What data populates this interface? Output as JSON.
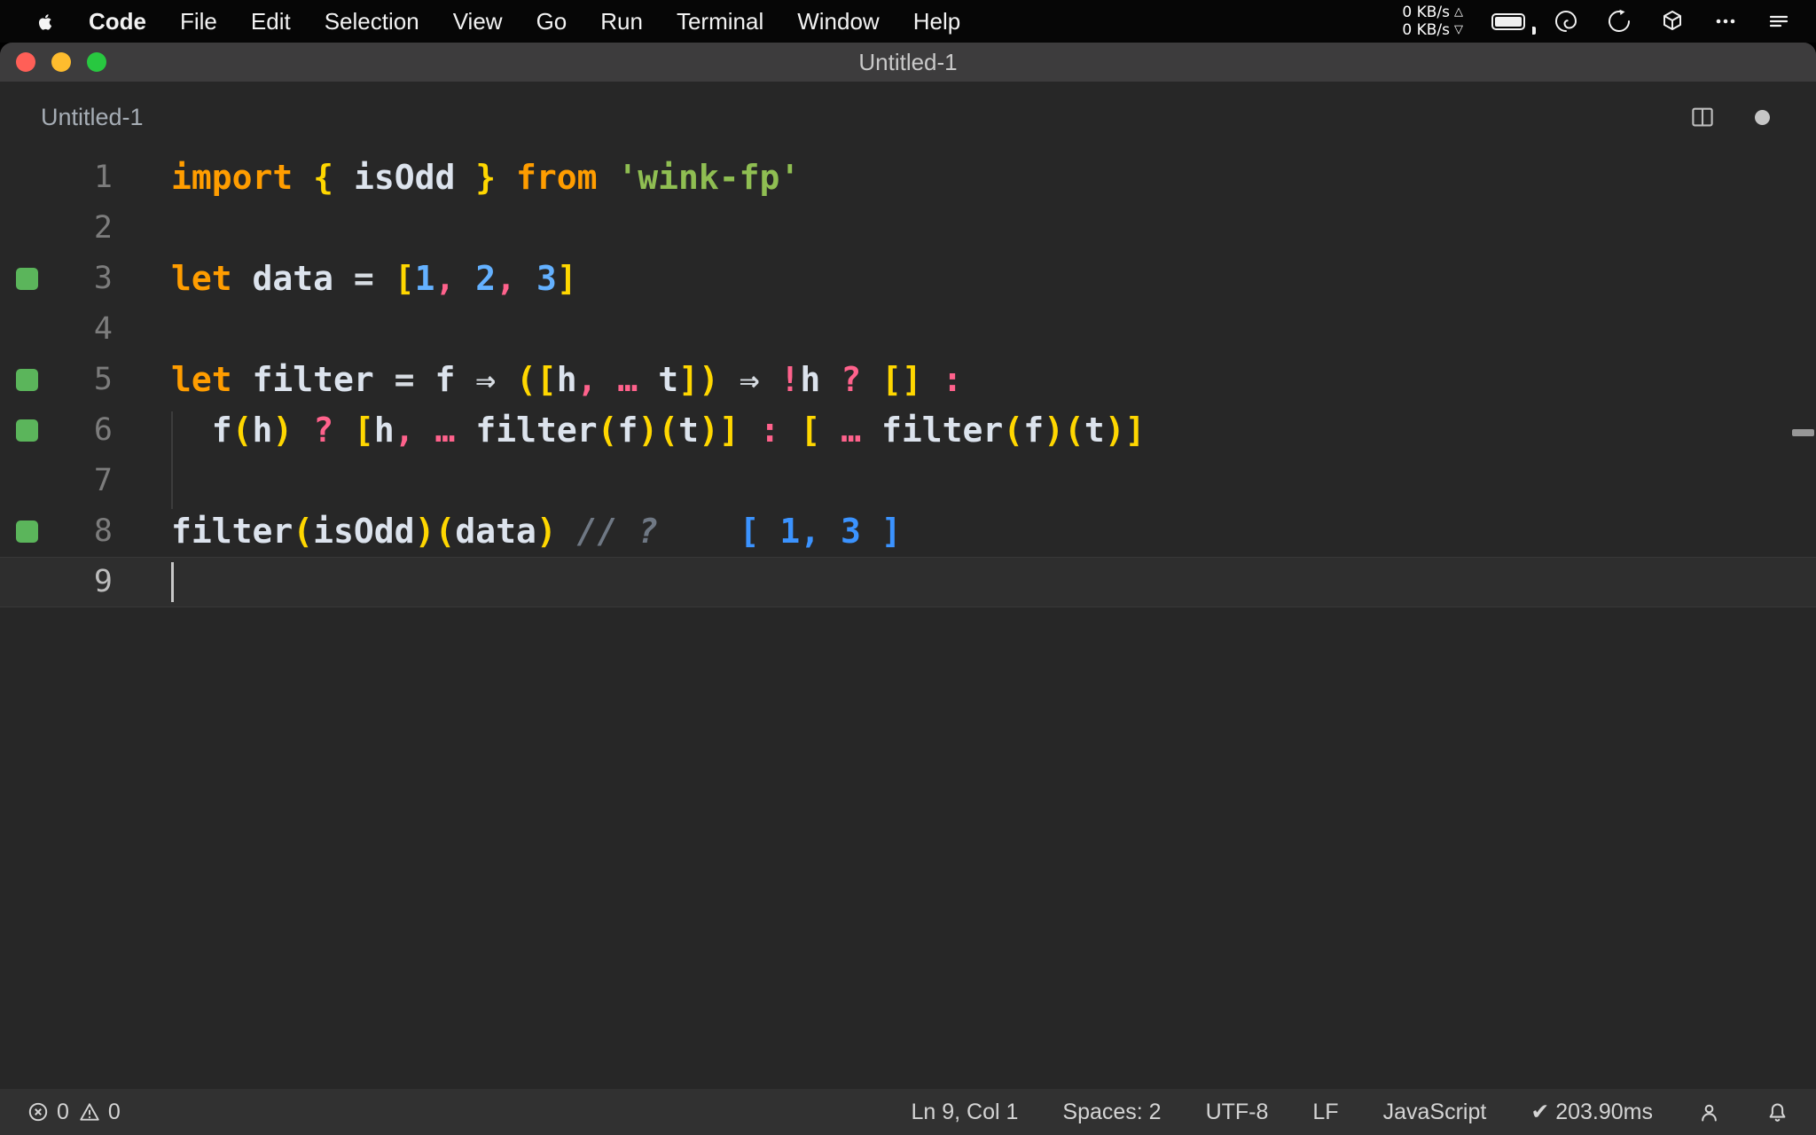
{
  "menu_bar": {
    "items": [
      {
        "label": "Code",
        "bold": true
      },
      {
        "label": "File"
      },
      {
        "label": "Edit"
      },
      {
        "label": "Selection"
      },
      {
        "label": "View"
      },
      {
        "label": "Go"
      },
      {
        "label": "Run"
      },
      {
        "label": "Terminal"
      },
      {
        "label": "Window"
      },
      {
        "label": "Help"
      }
    ],
    "network": {
      "up_label": "0 KB/s",
      "up_arrow": "△",
      "down_label": "0 KB/s",
      "down_arrow": "▽"
    }
  },
  "window": {
    "title": "Untitled-1",
    "tab_label": "Untitled-1"
  },
  "editor": {
    "language_hint": "JavaScript",
    "lines": [
      {
        "num": "1",
        "marker": false,
        "tokens": [
          [
            "kw",
            "import"
          ],
          [
            "id",
            " "
          ],
          [
            "br",
            "{"
          ],
          [
            "id",
            " isOdd "
          ],
          [
            "br",
            "}"
          ],
          [
            "id",
            " "
          ],
          [
            "kw",
            "from"
          ],
          [
            "id",
            " "
          ],
          [
            "str",
            "'wink-fp'"
          ]
        ]
      },
      {
        "num": "2",
        "marker": false,
        "tokens": []
      },
      {
        "num": "3",
        "marker": true,
        "tokens": [
          [
            "kw",
            "let"
          ],
          [
            "id",
            " data "
          ],
          [
            "wt",
            "="
          ],
          [
            "id",
            " "
          ],
          [
            "br",
            "["
          ],
          [
            "num",
            "1"
          ],
          [
            "pk",
            ","
          ],
          [
            "id",
            " "
          ],
          [
            "num",
            "2"
          ],
          [
            "pk",
            ","
          ],
          [
            "id",
            " "
          ],
          [
            "num",
            "3"
          ],
          [
            "br",
            "]"
          ]
        ]
      },
      {
        "num": "4",
        "marker": false,
        "tokens": []
      },
      {
        "num": "5",
        "marker": true,
        "tokens": [
          [
            "kw",
            "let"
          ],
          [
            "id",
            " filter "
          ],
          [
            "wt",
            "="
          ],
          [
            "id",
            " f "
          ],
          [
            "wt",
            "⇒"
          ],
          [
            "id",
            " "
          ],
          [
            "br",
            "(["
          ],
          [
            "id",
            "h"
          ],
          [
            "pk",
            ","
          ],
          [
            "id",
            " "
          ],
          [
            "pk",
            "…"
          ],
          [
            "id",
            " "
          ],
          [
            "id",
            "t"
          ],
          [
            "br",
            "])"
          ],
          [
            "id",
            " "
          ],
          [
            "wt",
            "⇒"
          ],
          [
            "id",
            " "
          ],
          [
            "pk",
            "!"
          ],
          [
            "id",
            "h"
          ],
          [
            "id",
            " "
          ],
          [
            "pk",
            "?"
          ],
          [
            "id",
            " "
          ],
          [
            "br",
            "[]"
          ],
          [
            "id",
            " "
          ],
          [
            "pk",
            ":"
          ]
        ]
      },
      {
        "num": "6",
        "marker": true,
        "tokens": [
          [
            "id",
            "  f"
          ],
          [
            "br",
            "("
          ],
          [
            "id",
            "h"
          ],
          [
            "br",
            ")"
          ],
          [
            "id",
            " "
          ],
          [
            "pk",
            "?"
          ],
          [
            "id",
            " "
          ],
          [
            "br",
            "["
          ],
          [
            "id",
            "h"
          ],
          [
            "pk",
            ","
          ],
          [
            "id",
            " "
          ],
          [
            "pk",
            "…"
          ],
          [
            "id",
            " "
          ],
          [
            "id",
            "filter"
          ],
          [
            "br",
            "("
          ],
          [
            "id",
            "f"
          ],
          [
            "br",
            ")("
          ],
          [
            "id",
            "t"
          ],
          [
            "br",
            ")]"
          ],
          [
            "id",
            " "
          ],
          [
            "pk",
            ":"
          ],
          [
            "id",
            " "
          ],
          [
            "br",
            "["
          ],
          [
            "id",
            " "
          ],
          [
            "pk",
            "…"
          ],
          [
            "id",
            " "
          ],
          [
            "id",
            "filter"
          ],
          [
            "br",
            "("
          ],
          [
            "id",
            "f"
          ],
          [
            "br",
            ")("
          ],
          [
            "id",
            "t"
          ],
          [
            "br",
            ")]"
          ]
        ]
      },
      {
        "num": "7",
        "marker": false,
        "tokens": []
      },
      {
        "num": "8",
        "marker": true,
        "tokens": [
          [
            "id",
            "filter"
          ],
          [
            "br",
            "("
          ],
          [
            "id",
            "isOdd"
          ],
          [
            "br",
            ")("
          ],
          [
            "id",
            "data"
          ],
          [
            "br",
            ")"
          ],
          [
            "id",
            " "
          ],
          [
            "cm",
            "// ?"
          ],
          [
            "id",
            "    "
          ],
          [
            "res",
            "[ 1, 3 ]"
          ]
        ]
      },
      {
        "num": "9",
        "marker": false,
        "active": true,
        "cursor": true,
        "tokens": []
      }
    ]
  },
  "status_bar": {
    "errors": "0",
    "warnings": "0",
    "position": "Ln 9, Col 1",
    "indentation": "Spaces: 2",
    "encoding": "UTF-8",
    "eol": "LF",
    "language": "JavaScript",
    "timing": "✔ 203.90ms"
  },
  "colors": {
    "menu_bar_bg": "#060606",
    "titlebar_bg": "#3d3c3d",
    "editor_bg": "#272727",
    "statusbar_bg": "#313131",
    "keyword_orange": "#ff9d00",
    "bracket_yellow": "#ffd700",
    "identifier_white": "#dce3ed",
    "number_blue": "#64b1ff",
    "operator_pink": "#ff628c",
    "string_green": "#8fbe52",
    "comment_gray": "#6f7884",
    "result_blue": "#3b93ff",
    "marker_green": "#5bb55b",
    "traffic_red": "#ff5f57",
    "traffic_yellow": "#febc2e",
    "traffic_green": "#28c840"
  }
}
